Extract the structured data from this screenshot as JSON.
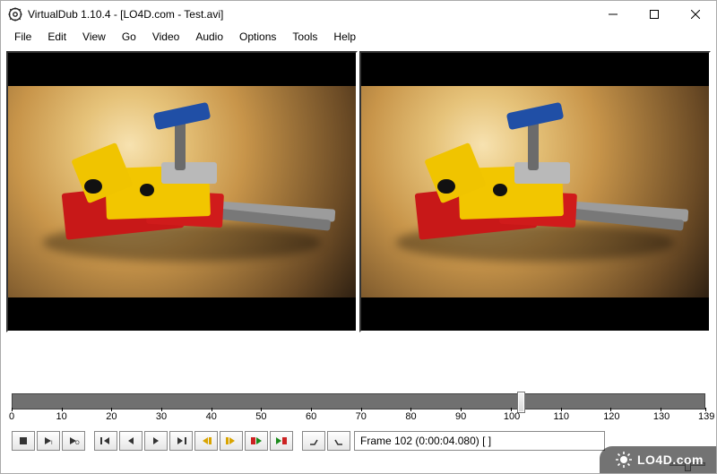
{
  "window": {
    "title": "VirtualDub 1.10.4 - [LO4D.com - Test.avi]"
  },
  "menu": {
    "items": [
      "File",
      "Edit",
      "View",
      "Go",
      "Video",
      "Audio",
      "Options",
      "Tools",
      "Help"
    ]
  },
  "timeline": {
    "min": 0,
    "max": 139,
    "current": 102,
    "ticks": [
      0,
      10,
      20,
      30,
      40,
      50,
      60,
      70,
      80,
      90,
      100,
      110,
      120,
      130,
      139
    ]
  },
  "controls": {
    "names": [
      "stop-button",
      "play-input-button",
      "play-output-button",
      "go-start-button",
      "prev-frame-button",
      "next-frame-button",
      "go-end-button",
      "prev-keyframe-button",
      "next-keyframe-button",
      "prev-scene-button",
      "next-scene-button",
      "mark-in-button",
      "mark-out-button"
    ]
  },
  "status": {
    "text": "Frame 102 (0:00:04.080) [ ]"
  },
  "watermark": {
    "text": "LO4D.com"
  }
}
